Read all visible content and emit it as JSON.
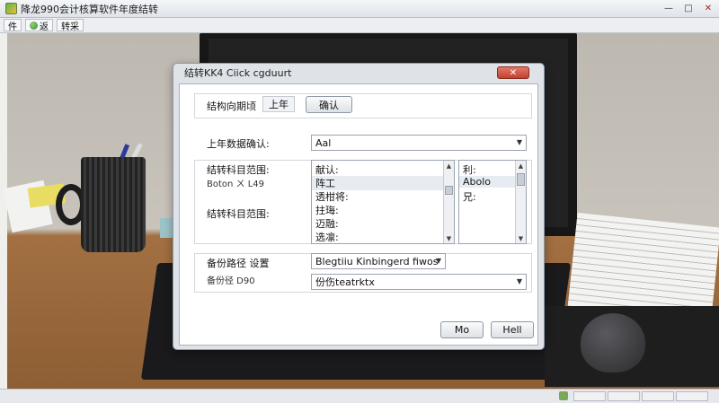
{
  "app": {
    "title": "降龙990会计核算软件年度结转",
    "window_controls": {
      "minimize": "—",
      "maximize": "□",
      "close": "✕"
    }
  },
  "toolbar": {
    "items": [
      {
        "label": "件",
        "icon": ""
      },
      {
        "label": "返",
        "icon": "refresh-icon"
      },
      {
        "label": "转采",
        "icon": ""
      }
    ]
  },
  "dialog": {
    "title": "结转KK4 Ciick cgduurt",
    "close_label": "✕",
    "section1": {
      "label": "结构向期顷",
      "tab_label": "上年",
      "confirm_button": "确认"
    },
    "prev_year_label": "上年数据确认:",
    "prev_year_value": "Aal",
    "range_label": "结转科目范围:",
    "range_sub_label": "Boton ㄨ L49",
    "range_label2": "结转科目范围:",
    "account_list": {
      "items": [
        "献认:",
        "阵工",
        "透柑将:",
        "拄珻:",
        "迈融:",
        "选凛:"
      ],
      "selected_index": 1
    },
    "side_list": {
      "items": [
        "利:",
        "Abolo",
        "兄:"
      ]
    },
    "backup": {
      "label": "备份路径 设置",
      "sub_label": "备份径 D90",
      "path_select": "Blegtiiu Kinbingerd fiwos",
      "path_input": "份伤teatrktx"
    },
    "ok_button": "Mo",
    "cancel_button": "Hell"
  },
  "colors": {
    "dialog_close": "#c0412f",
    "selection": "#e7ecf2",
    "title_bar": "#dfe4ea"
  }
}
